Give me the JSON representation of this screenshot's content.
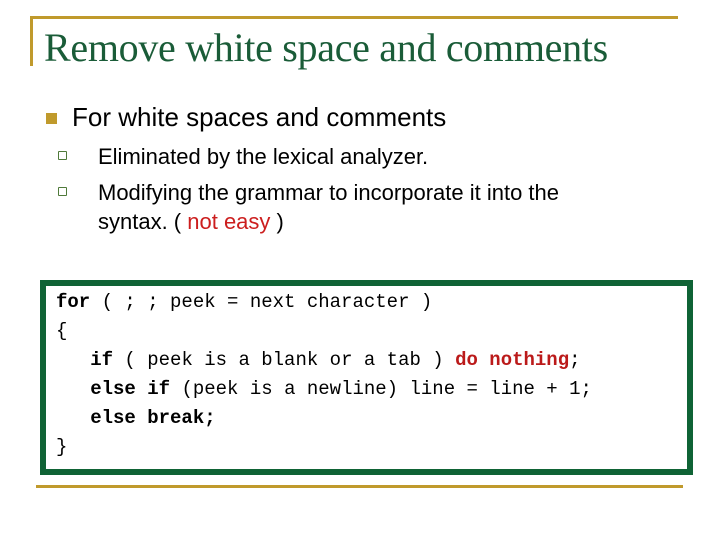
{
  "slide": {
    "title": "Remove white space and comments",
    "colors": {
      "accent_gold": "#C09A2C",
      "title_green": "#1A5C38",
      "box_border_green": "#0F6335",
      "highlight_red": "#CC1E1E"
    },
    "bullets": [
      {
        "level": 1,
        "text": "For white spaces and comments",
        "marker": "filled-square-icon",
        "children": [
          {
            "level": 2,
            "text": "Eliminated by the lexical analyzer.",
            "marker": "hollow-square-icon"
          },
          {
            "level": 2,
            "text": "Modifying the grammar to incorporate it into the",
            "text_line2_prefix": "syntax. ( ",
            "text_line2_highlight": "not easy",
            "text_line2_suffix": " )",
            "marker": "hollow-square-icon"
          }
        ]
      }
    ],
    "code": {
      "lines": [
        {
          "kw": "for",
          "rest": " ( ; ; peek = next character )"
        },
        {
          "text": "{"
        },
        {
          "indent": "   ",
          "kw": "if",
          "rest": " ( peek is a blank or a tab ) ",
          "kw_red": "do nothing",
          "tail": ";"
        },
        {
          "indent": "   ",
          "kw": "else if",
          "rest": " (peek is a newline) line = line + 1;"
        },
        {
          "indent": "   ",
          "kw": "else break;"
        },
        {
          "text": "}"
        }
      ]
    }
  }
}
